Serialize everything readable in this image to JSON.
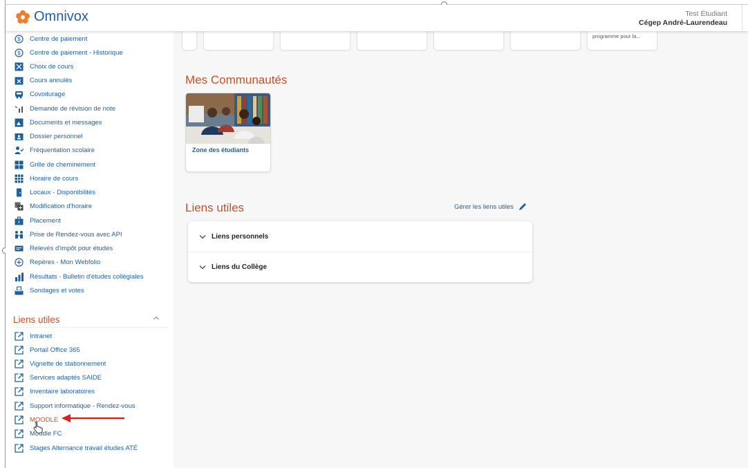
{
  "header": {
    "app_name": "Omnivox",
    "user_name": "Test Étudiant",
    "institution": "Cégep André-Laurendeau"
  },
  "sidebar": {
    "services": [
      {
        "label": "Centre de paiement",
        "icon": "payment-icon"
      },
      {
        "label": "Centre de paiement - Historique",
        "icon": "payment-history-icon"
      },
      {
        "label": "Choix de cours",
        "icon": "course-choice-icon"
      },
      {
        "label": "Cours annulés",
        "icon": "cancelled-courses-icon"
      },
      {
        "label": "Covoiturage",
        "icon": "carpool-icon"
      },
      {
        "label": "Demande de révision de note",
        "icon": "grade-review-icon"
      },
      {
        "label": "Documents et messages",
        "icon": "documents-icon"
      },
      {
        "label": "Dossier personnel",
        "icon": "personal-file-icon"
      },
      {
        "label": "Fréquentation scolaire",
        "icon": "attendance-icon"
      },
      {
        "label": "Grille de cheminement",
        "icon": "progress-grid-icon"
      },
      {
        "label": "Horaire de cours",
        "icon": "schedule-icon"
      },
      {
        "label": "Locaux - Disponibilités",
        "icon": "rooms-icon"
      },
      {
        "label": "Modification d'horaire",
        "icon": "schedule-change-icon"
      },
      {
        "label": "Placement",
        "icon": "briefcase-icon"
      },
      {
        "label": "Prise de Rendez-vous avec API",
        "icon": "appointment-icon"
      },
      {
        "label": "Relevés d'impôt pour études",
        "icon": "tax-receipt-icon"
      },
      {
        "label": "Repères - Mon Webfolio",
        "icon": "webfolio-icon"
      },
      {
        "label": "Résultats - Bulletin d'études collégiales",
        "icon": "results-chart-icon"
      },
      {
        "label": "Sondages et votes",
        "icon": "ballot-icon"
      }
    ],
    "useful_links_title": "Liens utiles",
    "useful_links": [
      {
        "label": "Intranet"
      },
      {
        "label": "Portail Office 365"
      },
      {
        "label": "Vignette de stationnement"
      },
      {
        "label": "Services adaptés SAIDE"
      },
      {
        "label": "Inventaire laboratoires"
      },
      {
        "label": "Support informatique - Rendez-vous"
      },
      {
        "label": "MOODLE"
      },
      {
        "label": "Moodle FC"
      },
      {
        "label": "Stages Alternance travail études ATÉ"
      }
    ]
  },
  "main": {
    "top_card_text": "programme pour la...",
    "communities_title": "Mes Communautés",
    "community_card": {
      "label": "Zone des étudiants"
    },
    "links_title": "Liens utiles",
    "manage_links_label": "Gérer les liens utiles",
    "accordion": [
      {
        "label": "Liens personnels"
      },
      {
        "label": "Liens du Collège"
      }
    ]
  },
  "colors": {
    "brand_blue": "#1f5f9e",
    "heading_orange": "#c0522a",
    "logo_orange": "#ee7d2c",
    "annotation_red": "#e0201c"
  }
}
